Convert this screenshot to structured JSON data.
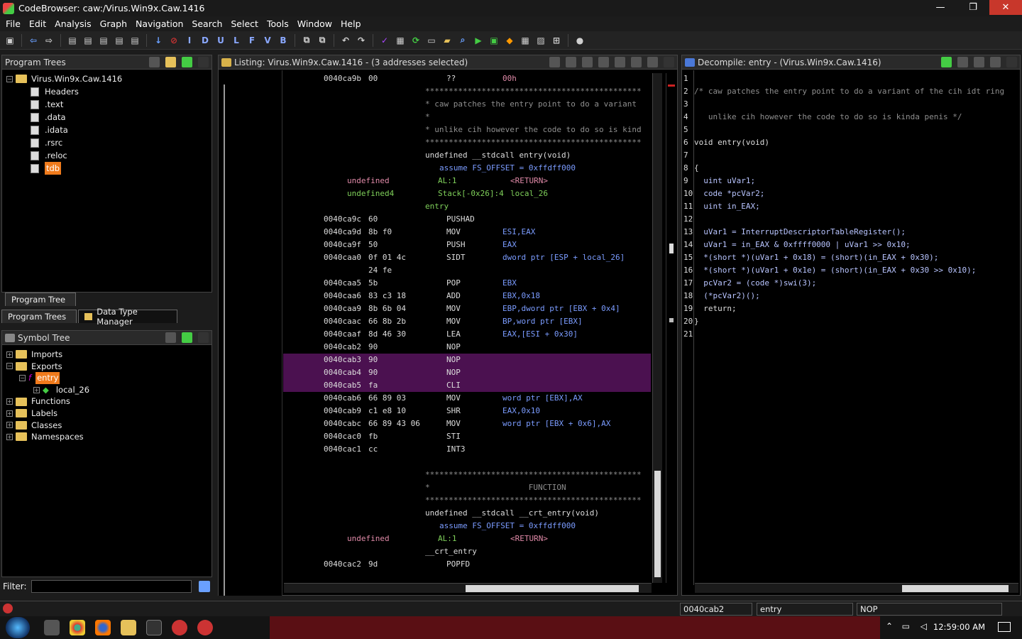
{
  "window": {
    "title": "CodeBrowser: caw:/Virus.Win9x.Caw.1416",
    "min": "—",
    "max": "❐",
    "close": "✕"
  },
  "menu": [
    "File",
    "Edit",
    "Analysis",
    "Graph",
    "Navigation",
    "Search",
    "Select",
    "Tools",
    "Window",
    "Help"
  ],
  "program_trees": {
    "title": "Program Trees",
    "root": "Virus.Win9x.Caw.1416",
    "items": [
      "Headers",
      ".text",
      ".data",
      ".idata",
      ".rsrc",
      ".reloc",
      "tdb"
    ],
    "selected": "tdb",
    "tab_program_tree": "Program Tree"
  },
  "bottom_tabs": [
    "Program Trees",
    "Data Type Manager"
  ],
  "symbol_tree": {
    "title": "Symbol Tree",
    "items": [
      "Imports",
      "Exports",
      "entry",
      "local_26",
      "Functions",
      "Labels",
      "Classes",
      "Namespaces"
    ]
  },
  "filter": {
    "label": "Filter:",
    "value": ""
  },
  "listing": {
    "title": "Listing:  Virus.Win9x.Caw.1416 - (3 addresses selected)",
    "lines": [
      {
        "a": "0040ca9b",
        "b": "00",
        "m": "??",
        "o": "00h"
      },
      {
        "c": "**********************************************"
      },
      {
        "c": "* caw patches the entry point to do a variant"
      },
      {
        "c": "*"
      },
      {
        "c": "* unlike cih however the code to do so is kind"
      },
      {
        "c": "**********************************************"
      },
      {
        "s": "undefined __stdcall entry(void)"
      },
      {
        "s2": "assume FS_OFFSET = 0xffdff000"
      },
      {
        "v1": "undefined",
        "v2": "AL:1",
        "v3": "<RETURN>"
      },
      {
        "v1": "undefined4",
        "v2": "Stack[-0x26]:4",
        "v3": "local_26"
      },
      {
        "lbl": "entry"
      },
      {
        "a": "0040ca9c",
        "b": "60",
        "m": "PUSHAD",
        "o": ""
      },
      {
        "a": "0040ca9d",
        "b": "8b f0",
        "m": "MOV",
        "o": "ESI,EAX"
      },
      {
        "a": "0040ca9f",
        "b": "50",
        "m": "PUSH",
        "o": "EAX"
      },
      {
        "a": "0040caa0",
        "b": "0f 01 4c",
        "m": "SIDT",
        "o": "dword ptr [ESP + local_26]"
      },
      {
        "a": "",
        "b": "24 fe",
        "m": "",
        "o": ""
      },
      {
        "a": "0040caa5",
        "b": "5b",
        "m": "POP",
        "o": "EBX"
      },
      {
        "a": "0040caa6",
        "b": "83 c3 18",
        "m": "ADD",
        "o": "EBX,0x18"
      },
      {
        "a": "0040caa9",
        "b": "8b 6b 04",
        "m": "MOV",
        "o": "EBP,dword ptr [EBX + 0x4]"
      },
      {
        "a": "0040caac",
        "b": "66 8b 2b",
        "m": "MOV",
        "o": "BP,word ptr [EBX]"
      },
      {
        "a": "0040caaf",
        "b": "8d 46 30",
        "m": "LEA",
        "o": "EAX,[ESI + 0x30]"
      },
      {
        "a": "0040cab2",
        "b": "90",
        "m": "NOP",
        "o": ""
      },
      {
        "a": "0040cab3",
        "b": "90",
        "m": "NOP",
        "o": ""
      },
      {
        "a": "0040cab4",
        "b": "90",
        "m": "NOP",
        "o": ""
      },
      {
        "a": "0040cab5",
        "b": "fa",
        "m": "CLI",
        "o": ""
      },
      {
        "a": "0040cab6",
        "b": "66 89 03",
        "m": "MOV",
        "o": "word ptr [EBX],AX"
      },
      {
        "a": "0040cab9",
        "b": "c1 e8 10",
        "m": "SHR",
        "o": "EAX,0x10"
      },
      {
        "a": "0040cabc",
        "b": "66 89 43 06",
        "m": "MOV",
        "o": "word ptr [EBX + 0x6],AX"
      },
      {
        "a": "0040cac0",
        "b": "fb",
        "m": "STI",
        "o": ""
      },
      {
        "a": "0040cac1",
        "b": "cc",
        "m": "INT3",
        "o": ""
      },
      {
        "blank": ""
      },
      {
        "c": "**********************************************"
      },
      {
        "c": "*                     FUNCTION"
      },
      {
        "c": "**********************************************"
      },
      {
        "s": "undefined __stdcall __crt_entry(void)"
      },
      {
        "s2": "assume FS_OFFSET = 0xffdff000"
      },
      {
        "v1": "undefined",
        "v2": "AL:1",
        "v3": "<RETURN>"
      },
      {
        "lbl": "__crt_entry"
      },
      {
        "a": "0040cac2",
        "b": "9d",
        "m": "POPFD",
        "o": ""
      }
    ]
  },
  "decompile": {
    "title": "Decompile: entry -  (Virus.Win9x.Caw.1416)",
    "lines": [
      "",
      "/* caw patches the entry point to do a variant of the cih idt ring",
      "",
      "   unlike cih however the code to do so is kinda penis */",
      "",
      "void entry(void)",
      "",
      "{",
      "  uint uVar1;",
      "  code *pcVar2;",
      "  uint in_EAX;",
      "",
      "  uVar1 = InterruptDescriptorTableRegister();",
      "  uVar1 = in_EAX & 0xffff0000 | uVar1 >> 0x10;",
      "  *(short *)(uVar1 + 0x18) = (short)(in_EAX + 0x30);",
      "  *(short *)(uVar1 + 0x1e) = (short)(in_EAX + 0x30 >> 0x10);",
      "  pcVar2 = (code *)swi(3);",
      "  (*pcVar2)();",
      "  return;",
      "}",
      ""
    ]
  },
  "status": {
    "address": "0040cab2",
    "function": "entry",
    "instruction": "NOP"
  },
  "clock": "12:59:00 AM"
}
